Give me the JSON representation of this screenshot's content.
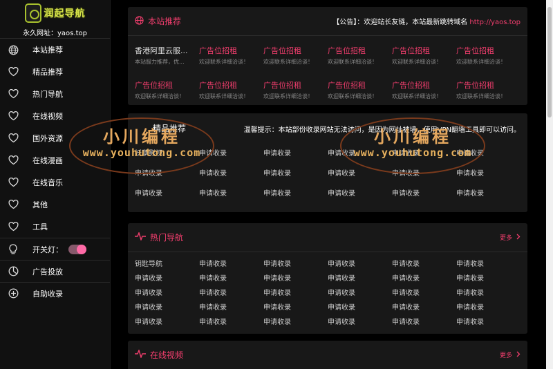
{
  "logo": {
    "text": "润起导航",
    "domain_label": "永久网址：yaos.top"
  },
  "sidebar": {
    "items": [
      {
        "label": "本站推荐",
        "icon": "globe-icon"
      },
      {
        "label": "精品推荐",
        "icon": "heart-icon"
      },
      {
        "label": "热门导航",
        "icon": "heart-icon"
      },
      {
        "label": "在线视频",
        "icon": "heart-icon"
      },
      {
        "label": "国外资源",
        "icon": "heart-icon"
      },
      {
        "label": "在线漫画",
        "icon": "heart-icon"
      },
      {
        "label": "在线音乐",
        "icon": "heart-icon"
      },
      {
        "label": "其他",
        "icon": "heart-icon"
      },
      {
        "label": "工具",
        "icon": "heart-icon"
      }
    ],
    "light_label": "开关灯：",
    "light_on": true,
    "ad_label": "广告投放",
    "submit_label": "自助收录"
  },
  "recommend": {
    "title": "本站推荐",
    "notice": "【公告】：欢迎站长友链，本站最新跳转域名 ",
    "notice_link": "http://yaos.top",
    "row1": [
      {
        "name": "香港阿里云服...",
        "desc": "本站服力推荐，优...",
        "ad": false
      },
      {
        "name": "广告位招租",
        "desc": "欢迎联系详细洽谈！",
        "ad": true
      },
      {
        "name": "广告位招租",
        "desc": "欢迎联系详细洽谈！",
        "ad": true
      },
      {
        "name": "广告位招租",
        "desc": "欢迎联系详细洽谈！",
        "ad": true
      },
      {
        "name": "广告位招租",
        "desc": "欢迎联系详细洽谈！",
        "ad": true
      },
      {
        "name": "广告位招租",
        "desc": "欢迎联系详细洽谈！",
        "ad": true
      }
    ],
    "row2": [
      {
        "name": "广告位招租",
        "desc": "欢迎联系详细洽谈！",
        "ad": true
      },
      {
        "name": "广告位招租",
        "desc": "欢迎联系详细洽谈！",
        "ad": true
      },
      {
        "name": "广告位招租",
        "desc": "欢迎联系详细洽谈！",
        "ad": true
      },
      {
        "name": "广告位招租",
        "desc": "欢迎联系详细洽谈！",
        "ad": true
      },
      {
        "name": "广告位招租",
        "desc": "欢迎联系详细洽谈！",
        "ad": true
      },
      {
        "name": "广告位招租",
        "desc": "欢迎联系详细洽谈！",
        "ad": true
      }
    ]
  },
  "premium": {
    "title": "精品推荐",
    "notice": "温馨提示：本站部份收录网站无法访问，是因为网址被墙，使用VPN翻墙工具即可以访问。",
    "rows": [
      [
        "妖孽影视",
        "申请收录",
        "申请收录",
        "申请收录",
        "申请收录",
        "申请收录"
      ],
      [
        "申请收录",
        "申请收录",
        "申请收录",
        "申请收录",
        "申请收录",
        "申请收录"
      ],
      [
        "申请收录",
        "申请收录",
        "申请收录",
        "申请收录",
        "申请收录",
        "申请收录"
      ]
    ]
  },
  "hot": {
    "title": "热门导航",
    "more": "更多",
    "rows": [
      [
        "钥匙导航",
        "申请收录",
        "申请收录",
        "申请收录",
        "申请收录",
        "申请收录"
      ],
      [
        "申请收录",
        "申请收录",
        "申请收录",
        "申请收录",
        "申请收录",
        "申请收录"
      ],
      [
        "申请收录",
        "申请收录",
        "申请收录",
        "申请收录",
        "申请收录",
        "申请收录"
      ],
      [
        "申请收录",
        "申请收录",
        "申请收录",
        "申请收录",
        "申请收录",
        "申请收录"
      ],
      [
        "申请收录",
        "申请收录",
        "申请收录",
        "申请收录",
        "申请收录",
        "申请收录"
      ]
    ]
  },
  "video": {
    "title": "在线视频",
    "more": "更多"
  },
  "watermark": {
    "title": "小川编程",
    "url": "www.youhutong.com"
  },
  "colors": {
    "accent": "#f33e6e",
    "sidebar_bg": "#111111",
    "card_bg": "#181818",
    "toggle_knob": "#ff6aa6"
  }
}
